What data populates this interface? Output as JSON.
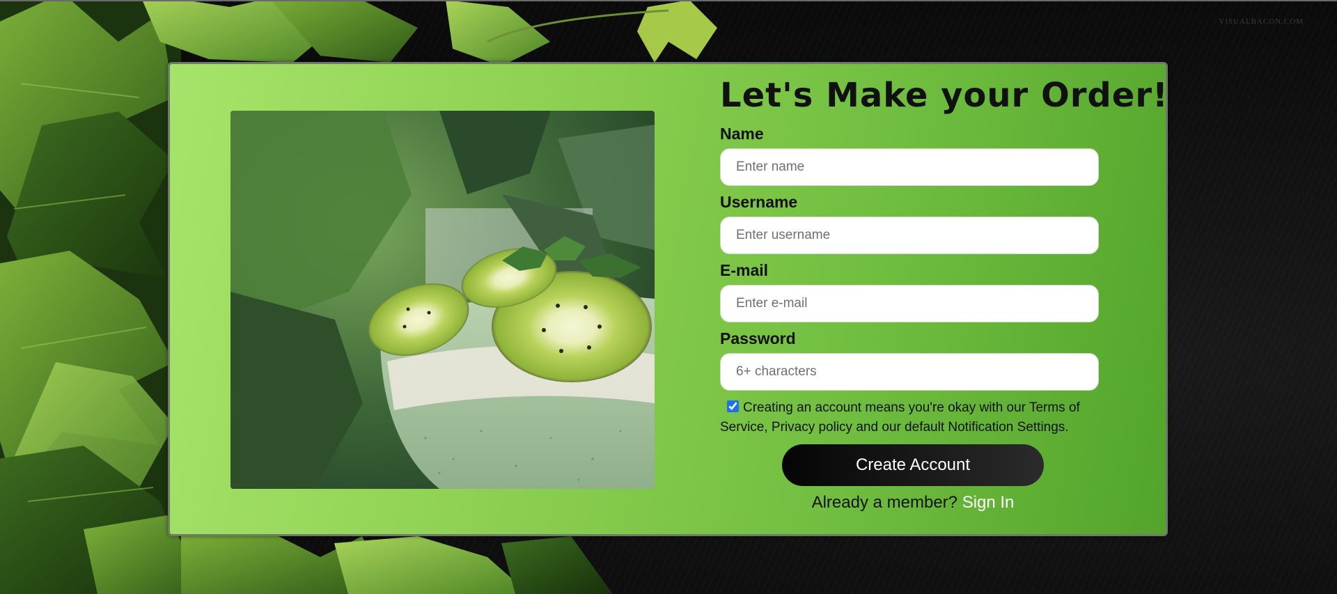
{
  "watermark": "VISUALBACON.COM",
  "form": {
    "title": "Let's Make your Order!",
    "fields": [
      {
        "label": "Name",
        "placeholder": "Enter name",
        "value": ""
      },
      {
        "label": "Username",
        "placeholder": "Enter username",
        "value": ""
      },
      {
        "label": "E-mail",
        "placeholder": "Enter e-mail",
        "value": ""
      },
      {
        "label": "Password",
        "placeholder": "6+ characters",
        "value": ""
      }
    ],
    "terms_checked": true,
    "terms_text": "Creating an account means you're okay with our Terms of Service, Privacy policy and our default Notification Settings.",
    "submit_label": "Create Account",
    "member_prompt": "Already a member?",
    "signin_label": "Sign In"
  },
  "image": {
    "subject": "kiwi smoothie glass with mint"
  },
  "colors": {
    "card_gradient_start": "#a6e36a",
    "card_gradient_end": "#53a42c",
    "button_bg": "#0b0b0b",
    "signin_link": "#ffffff",
    "page_bg": "#0b0b0b"
  }
}
